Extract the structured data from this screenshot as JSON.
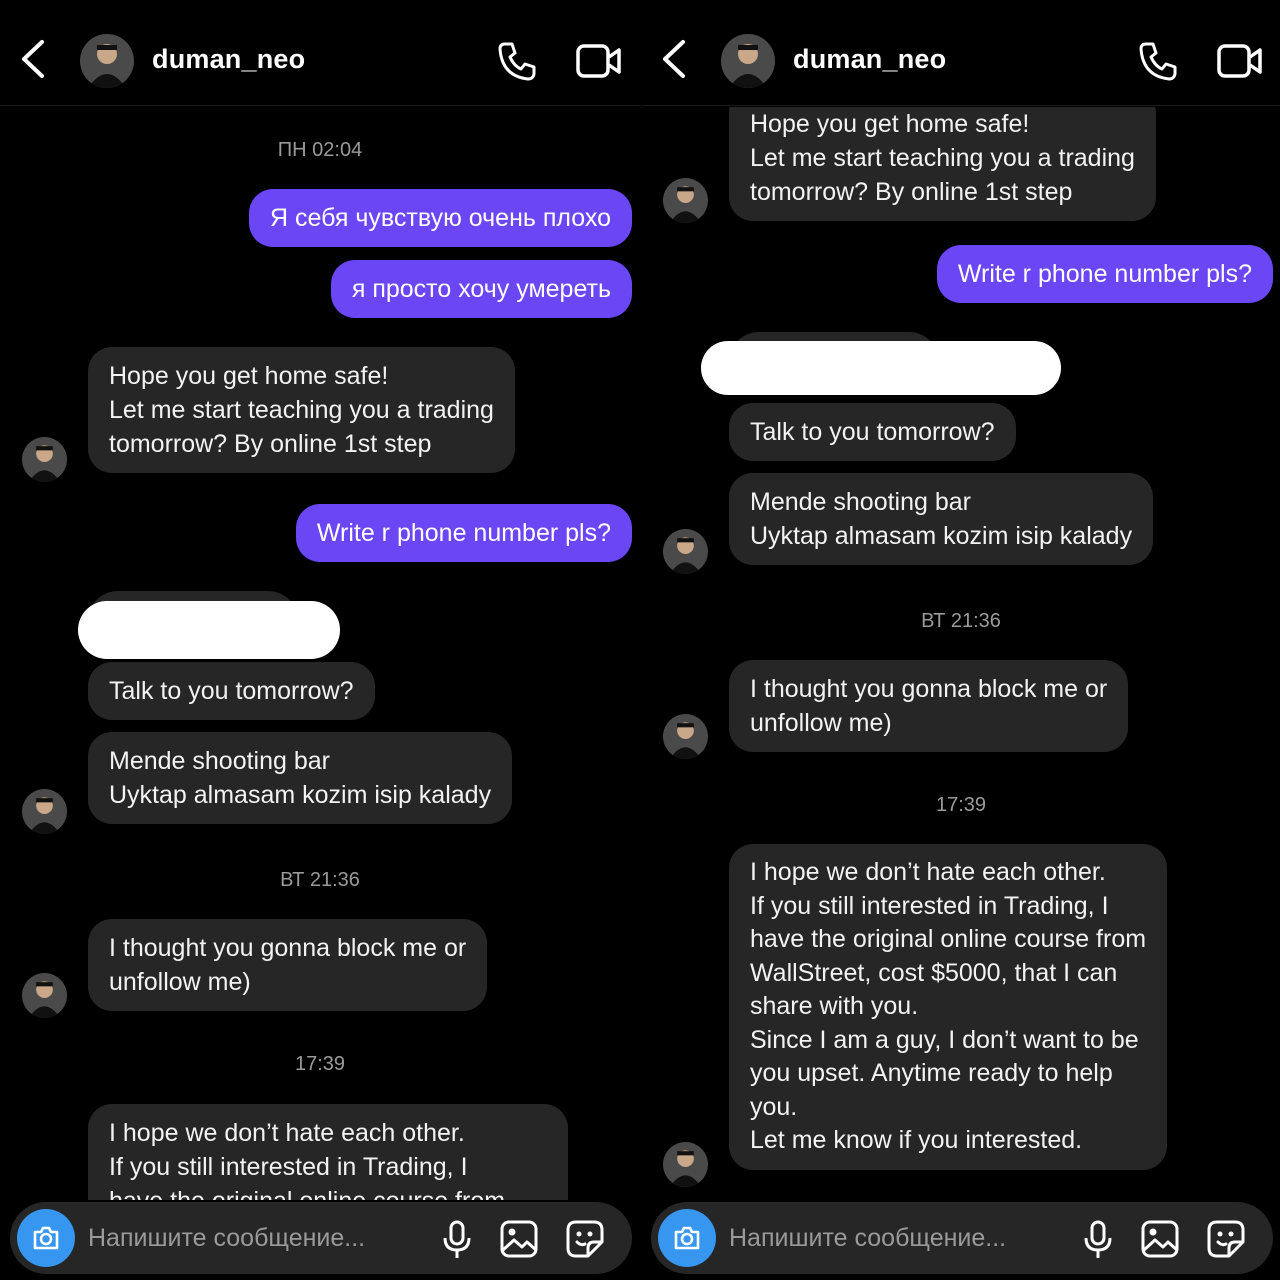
{
  "header": {
    "username": "duman_neo"
  },
  "colors": {
    "background": "#000000",
    "incoming_bubble": "#262626",
    "outgoing_bubble": "#6a46f5",
    "timestamp": "#9a9a9a",
    "camera_button": "#3797f0"
  },
  "icons": [
    "chevron-left-icon",
    "phone-icon",
    "video-camera-icon",
    "camera-icon",
    "microphone-icon",
    "gallery-icon",
    "sticker-icon"
  ],
  "composer": {
    "placeholder": "Напишите сообщение..."
  },
  "left": {
    "ts1": "ПН 02:04",
    "out1": "Я себя чувствую очень плохо",
    "out2": "я просто хочу умереть",
    "in1": [
      "Hope you get home safe!",
      "Let me start teaching you a trading",
      "tomorrow? By online 1st step"
    ],
    "out3": "Write r phone number pls?",
    "in2": "Talk to you tomorrow?",
    "in3": [
      "Mende shooting bar",
      "Uyktap almasam kozim isip kalady"
    ],
    "ts2": "ВТ 21:36",
    "in4": [
      "I thought you gonna block me or",
      "unfollow me)"
    ],
    "ts3": "17:39",
    "in5": [
      "I hope we don’t hate each other.",
      "If you still interested in Trading, I",
      "have the original online course from"
    ]
  },
  "right": {
    "in1": [
      "Hope you get home safe!",
      "Let me start teaching you a trading",
      "tomorrow? By online 1st step"
    ],
    "out1": "Write r phone number pls?",
    "in2": "Talk to you tomorrow?",
    "in3": [
      "Mende shooting bar",
      "Uyktap almasam kozim isip kalady"
    ],
    "ts1": "ВТ 21:36",
    "in4": [
      "I thought you gonna block me or",
      "unfollow me)"
    ],
    "ts2": "17:39",
    "in5": [
      "I hope we don’t hate each other.",
      "If you still interested in Trading, I",
      "have the original online course from",
      "WallStreet, cost $5000, that I can",
      "share with you.",
      "Since I am a guy, I don’t  want to be",
      "you upset. Anytime ready to help",
      "you.",
      "Let me know if you interested."
    ]
  }
}
